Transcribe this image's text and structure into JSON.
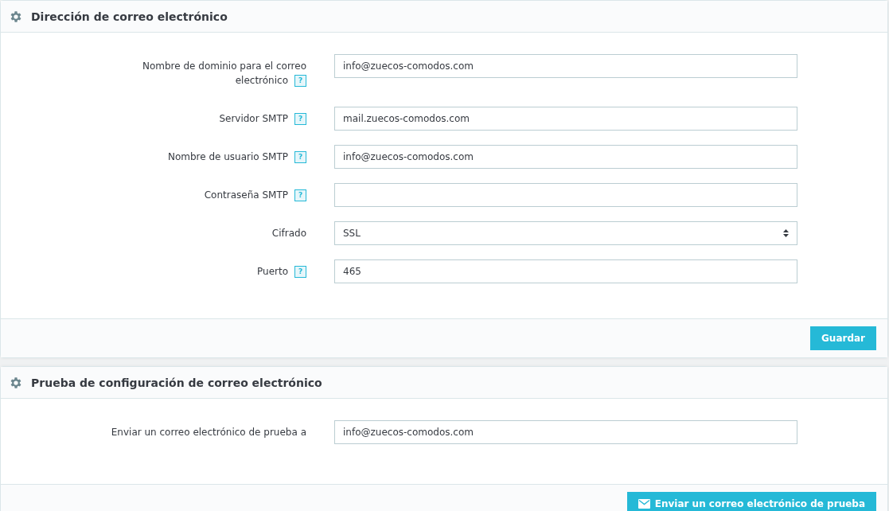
{
  "panels": [
    {
      "title": "Dirección de correo electrónico",
      "fields": [
        {
          "label": "Nombre de dominio para el correo electrónico",
          "help": "?",
          "kind": "text",
          "value": "info@zuecos-comodos.com"
        },
        {
          "label": "Servidor SMTP",
          "help": "?",
          "kind": "text",
          "value": "mail.zuecos-comodos.com"
        },
        {
          "label": "Nombre de usuario SMTP",
          "help": "?",
          "kind": "text",
          "value": "info@zuecos-comodos.com"
        },
        {
          "label": "Contraseña SMTP",
          "help": "?",
          "kind": "password"
        },
        {
          "label": "Cifrado",
          "kind": "select",
          "value": "SSL"
        },
        {
          "label": "Puerto",
          "help": "?",
          "kind": "text",
          "value": "465"
        }
      ],
      "button": {
        "label": "Guardar",
        "kind": "save"
      }
    },
    {
      "title": "Prueba de configuración de correo electrónico",
      "fields": [
        {
          "label": "Enviar un correo electrónico de prueba a",
          "kind": "text",
          "value": "info@zuecos-comodos.com"
        }
      ],
      "button": {
        "label": "Enviar un correo electrónico de prueba",
        "kind": "send"
      }
    }
  ]
}
